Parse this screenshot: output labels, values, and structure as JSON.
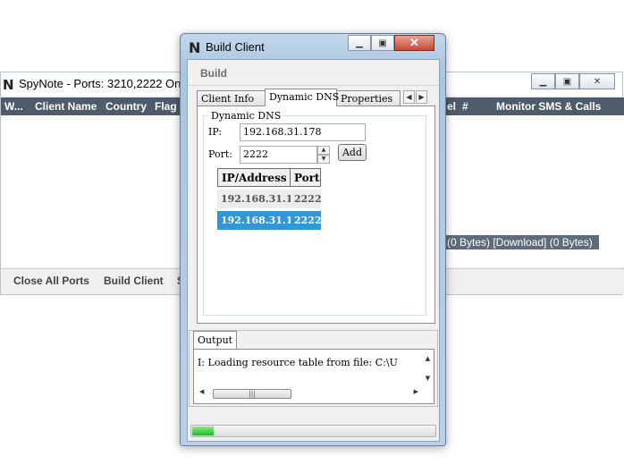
{
  "main_window": {
    "logo": "N",
    "title": "SpyNote - Ports: 3210,2222 Onl",
    "columns": [
      "W...",
      "Client Name",
      "Country",
      "Flag",
      "el",
      "#",
      "Monitor SMS & Calls"
    ],
    "transfer_status": "(0 Bytes) [Download] (0 Bytes)",
    "bottom_buttons": [
      "Close All Ports",
      "Build Client",
      "S"
    ]
  },
  "dialog": {
    "logo": "N",
    "title": "Build Client",
    "close_glyph": "✕",
    "menu": {
      "build": "Build"
    },
    "tabs": [
      "Client Info",
      "Dynamic DNS",
      "Properties"
    ],
    "active_tab": "Dynamic DNS",
    "dynamic_dns": {
      "group_label": "Dynamic DNS",
      "ip_label": "IP:",
      "ip_value": "192.168.31.178",
      "port_label": "Port:",
      "port_value": "2222",
      "add_button": "Add",
      "table_headers": [
        "IP/Address",
        "Port"
      ],
      "rows": [
        {
          "ip": "192.168.31.178",
          "port": "2222",
          "selected": false
        },
        {
          "ip": "192.168.31.178",
          "port": "2222",
          "selected": true
        }
      ]
    },
    "output": {
      "tab_label": "Output",
      "log_line": "I: Loading resource table from file: C:\\U"
    },
    "progress": 0.09
  },
  "colors": {
    "header_bg": "#4d5b6b",
    "selection": "#3296d7",
    "progress_green": "#1cbf26"
  }
}
